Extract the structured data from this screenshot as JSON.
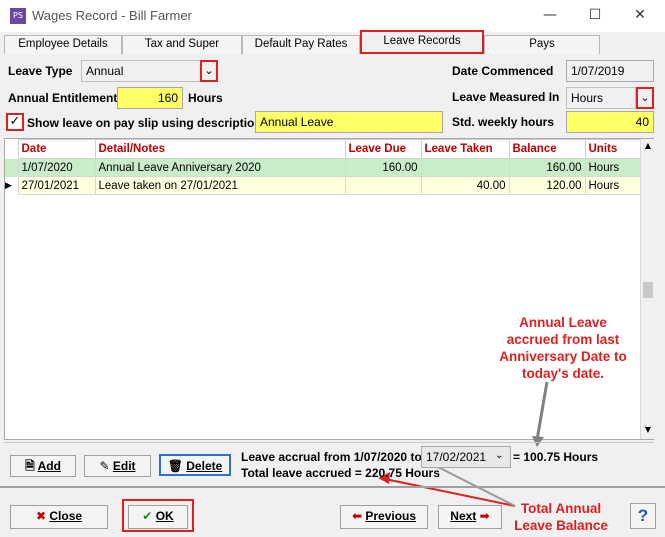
{
  "window": {
    "icon": "PS",
    "title": "Wages Record - Bill Farmer",
    "minimize": "—",
    "maximize": "☐",
    "close": "✕"
  },
  "tabs": [
    "Employee Details",
    "Tax and Super",
    "Default Pay Rates",
    "Leave Records",
    "Pays"
  ],
  "form": {
    "leave_type_label": "Leave Type",
    "leave_type_value": "Annual",
    "annual_entitlement_label": "Annual Entitlement",
    "annual_entitlement_value": "160",
    "hours_label": "Hours",
    "show_leave_label": "Show leave on pay slip using description",
    "show_leave_checked": true,
    "description_value": "Annual Leave",
    "date_commenced_label": "Date Commenced",
    "date_commenced_value": "1/07/2019",
    "leave_measured_label": "Leave Measured In",
    "leave_measured_value": "Hours",
    "std_weekly_label": "Std. weekly hours",
    "std_weekly_value": "40"
  },
  "table": {
    "columns": [
      "Date",
      "Detail/Notes",
      "Leave Due",
      "Leave Taken",
      "Balance",
      "Units"
    ],
    "rows": [
      {
        "date": "1/07/2020",
        "detail": "Annual Leave Anniversary 2020",
        "due": "160.00",
        "taken": "",
        "balance": "160.00",
        "units": "Hours"
      },
      {
        "date": "27/01/2021",
        "detail": "Leave taken on 27/01/2021",
        "due": "",
        "taken": "40.00",
        "balance": "120.00",
        "units": "Hours"
      }
    ]
  },
  "bottom": {
    "add": "Add",
    "edit": "Edit",
    "delete": "Delete",
    "accrual_label": "Leave accrual from 1/07/2020 to",
    "accrual_date": "17/02/2021",
    "accrual_result": "= 100.75 Hours",
    "total_accrued": "Total leave accrued = 220.75 Hours"
  },
  "footer": {
    "close": "Close",
    "ok": "OK",
    "previous": "Previous",
    "next": "Next",
    "help": "?"
  },
  "annotations": {
    "accrued_note": "Annual Leave accrued from last Anniversary Date to today's date.",
    "total_note": "Total Annual Leave Balance"
  },
  "colors": {
    "highlight": "#ffff66",
    "callout": "#e02020",
    "row_green": "#c9ecc9"
  }
}
